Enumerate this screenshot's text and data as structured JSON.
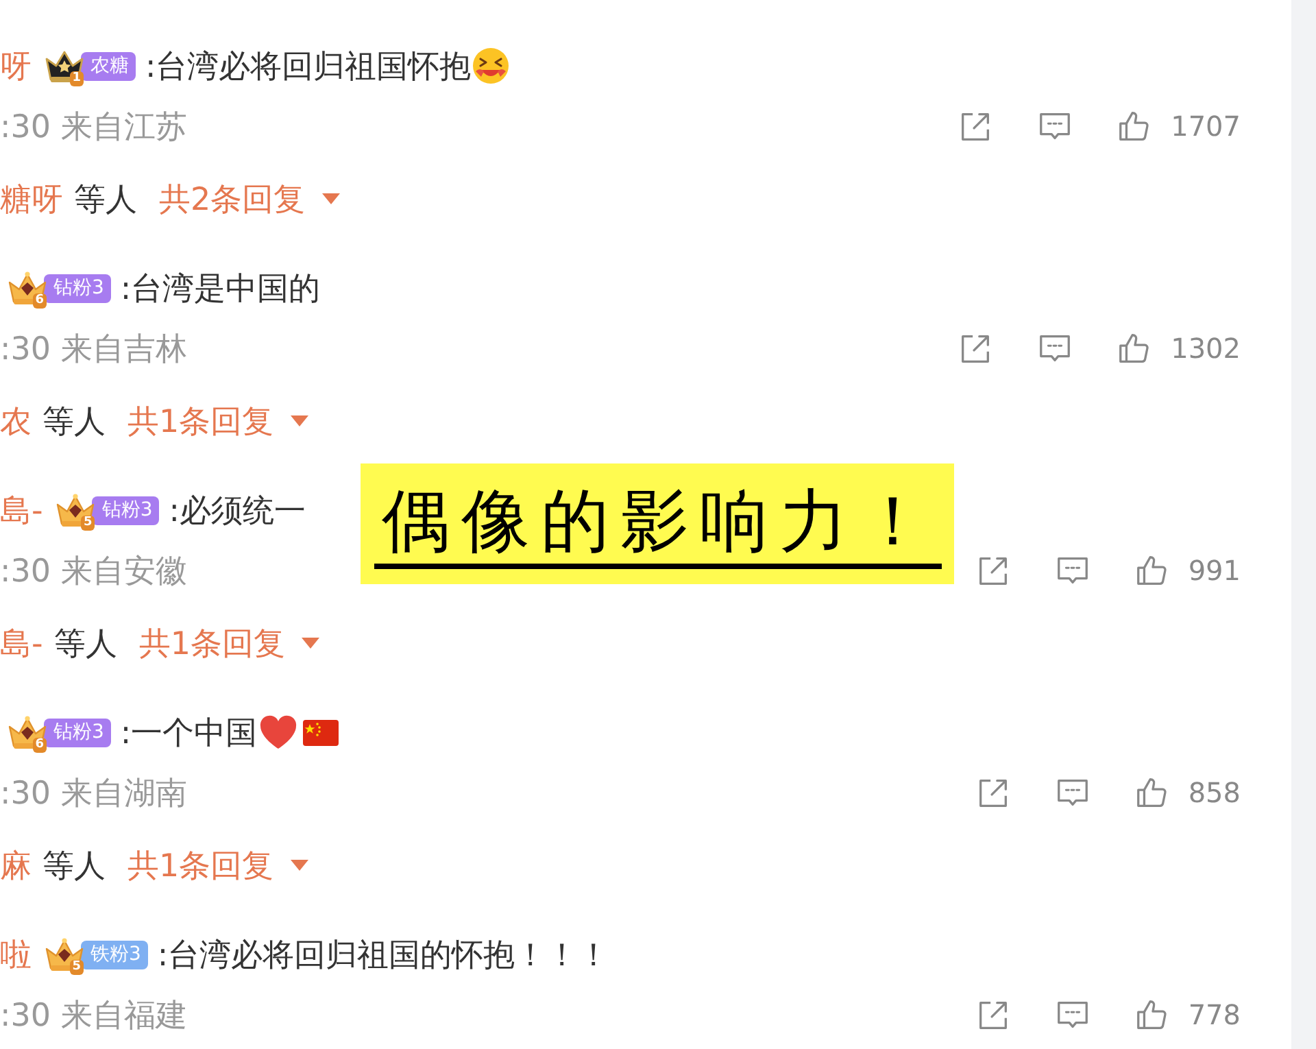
{
  "comments": [
    {
      "author": "呀",
      "crown": {
        "kind": "black",
        "level": "1"
      },
      "badge": {
        "label": "农糖",
        "color": "#a77cf0"
      },
      "text": ":台湾必将回归祖国怀抱",
      "emojis": [
        {
          "kind": "face"
        }
      ],
      "meta": ":30 来自江苏",
      "likes": "1707",
      "replies": {
        "author": "糖呀",
        "suffix": "等人",
        "count": "共2条回复"
      }
    },
    {
      "crown": {
        "kind": "gold",
        "level": "6"
      },
      "badge": {
        "label": "钻粉3",
        "color": "#a77cf0"
      },
      "text": ":台湾是中国的",
      "meta": ":30 来自吉林",
      "likes": "1302",
      "replies": {
        "author": "农",
        "suffix": "等人",
        "count": "共1条回复"
      }
    },
    {
      "author": "島-",
      "crown": {
        "kind": "gold",
        "level": "5"
      },
      "badge": {
        "label": "钻粉3",
        "color": "#a77cf0"
      },
      "text": ":必须统一",
      "meta": ":30 来自安徽",
      "likes": "991",
      "replies": {
        "author": "島-",
        "suffix": "等人",
        "count": "共1条回复"
      }
    },
    {
      "crown": {
        "kind": "gold",
        "level": "6"
      },
      "badge": {
        "label": "钻粉3",
        "color": "#a77cf0"
      },
      "text": ":一个中国",
      "emojis": [
        {
          "kind": "heart"
        },
        {
          "kind": "flag"
        }
      ],
      "meta": ":30 来自湖南",
      "likes": "858",
      "replies": {
        "author": "麻",
        "suffix": "等人",
        "count": "共1条回复"
      }
    },
    {
      "author": "啦",
      "crown": {
        "kind": "gold",
        "level": "5"
      },
      "badge": {
        "label": "铁粉3",
        "color": "#7fb0f2"
      },
      "text": ":台湾必将回归祖国的怀抱！！！",
      "meta": ":30 来自福建",
      "likes": "778"
    }
  ],
  "sticker": {
    "text": "偶像的影响力！"
  }
}
